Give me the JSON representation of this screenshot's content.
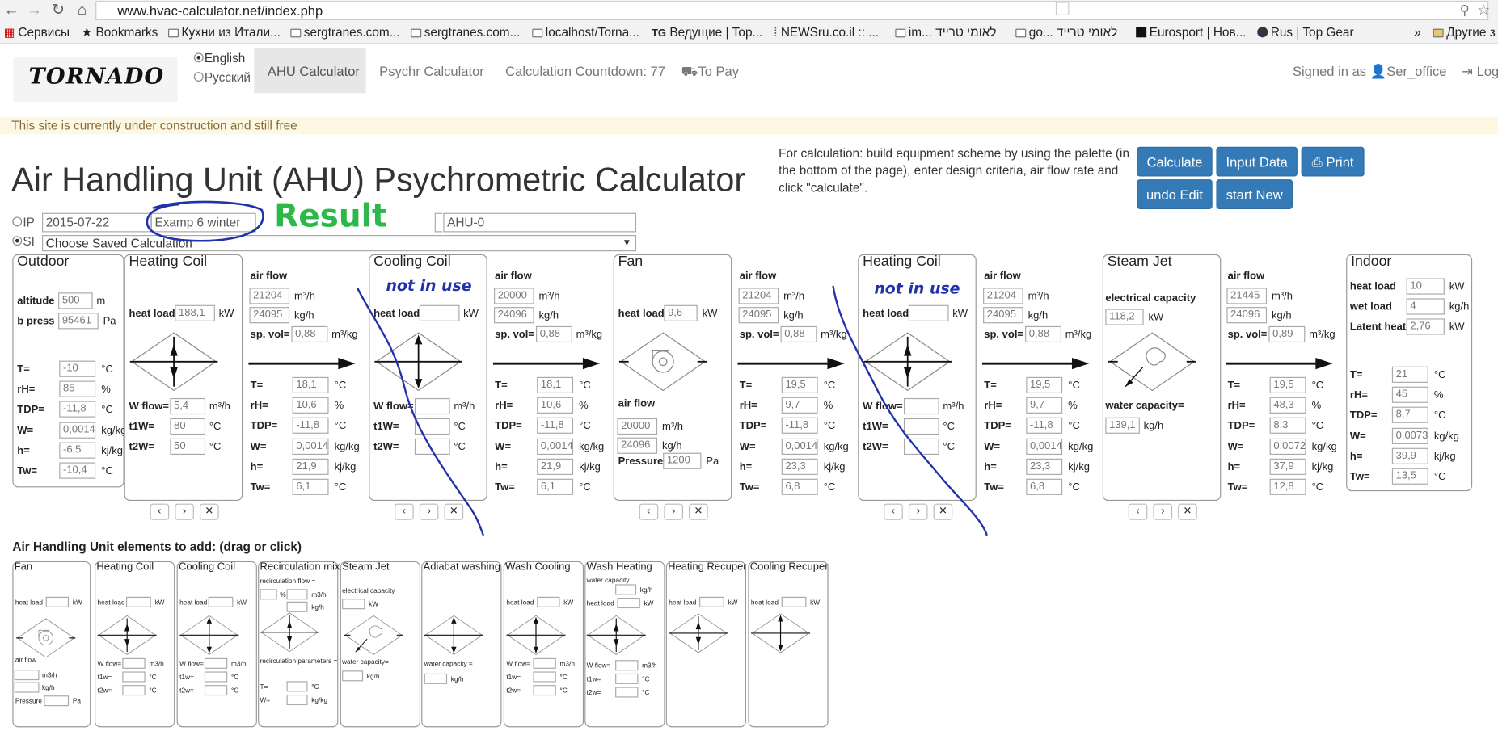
{
  "browser": {
    "url": "www.hvac-calculator.net/index.php",
    "bookmarks": [
      "Сервисы",
      "Bookmarks",
      "Кухни из Итали...",
      "sergtranes.com...",
      "sergtranes.com...",
      "localhost/Torna...",
      "Ведущие | Top...",
      "NEWSru.co.il :: ...",
      "im... לאומי טרייד",
      "go... לאומי טרייד",
      "Eurosport | Нов...",
      "Rus | Top Gear"
    ],
    "more": "»",
    "other_bookmarks": "Другие з"
  },
  "nav": {
    "logo": "TORNADO",
    "lang_en": "English",
    "lang_ru": "Русский",
    "ahu": "AHU Calculator",
    "psychr": "Psychr Calculator",
    "countdown": "Calculation Countdown: 77",
    "pay": "To Pay",
    "signed": "Signed in as ",
    "user": "Ser_office",
    "logout": "Log"
  },
  "warning": "This site is currently under construction and still free",
  "title": "Air Handling Unit (AHU) Psychrometric Calculator",
  "info": "For calculation: build equipment scheme by using the palette (in the bottom of the page), enter design criteria, air flow rate and click \"calculate\".",
  "buttons": {
    "calculate": "Calculate",
    "input": "Input Data",
    "print": "Print",
    "undo": "undo Edit",
    "start": "start New"
  },
  "units_ip": "IP",
  "units_si": "SI",
  "date": "2015-07-22",
  "name": "Examp 6 winter",
  "ahu_name": "AHU-0",
  "saved": "Choose Saved Calculation",
  "annotations": {
    "result": "Result",
    "notuse": "not in use"
  },
  "labels": {
    "T": "T=",
    "rH": "rH=",
    "TDP": "TDP=",
    "W": "W=",
    "h": "h=",
    "Tw": "Tw=",
    "airflow": "air flow",
    "spvol": "sp. vol=",
    "heatload": "heat load",
    "Wflow": "W flow=",
    "t1W": "t1W=",
    "t2W": "t2W=",
    "altitude": "altitude",
    "bpress": "b press",
    "pressure": "Pressure",
    "elcap": "electrical capacity",
    "watercap": "water capacity=",
    "wetload": "wet load",
    "latent": "Latent heat"
  },
  "units": {
    "C": "°C",
    "pct": "%",
    "kgkg": "kg/kg",
    "kjkg": "kj/kg",
    "m3h": "m³/h",
    "kgh": "kg/h",
    "m3kg": "m³/kg",
    "kW": "kW",
    "m": "m",
    "Pa": "Pa"
  },
  "outdoor": {
    "title": "Outdoor",
    "altitude": "500",
    "bpress": "95461",
    "T": "-10",
    "rH": "85",
    "TDP": "-11,8",
    "W": "0,00144",
    "h": "-6,5",
    "Tw": "-10,4"
  },
  "heat1": {
    "title": "Heating Coil",
    "heatload": "188,1",
    "Wflow": "5,4",
    "t1W": "80",
    "t2W": "50"
  },
  "flow1": {
    "airflow": "21204",
    "kgh": "24095",
    "spvol": "0,88",
    "T": "18,1",
    "rH": "10,6",
    "TDP": "-11,8",
    "W": "0,0014",
    "h": "21,9",
    "Tw": "6,1"
  },
  "cool": {
    "title": "Cooling Coil"
  },
  "flow2": {
    "airflow": "20000",
    "kgh": "24096",
    "spvol": "0,88",
    "T": "18,1",
    "rH": "10,6",
    "TDP": "-11,8",
    "W": "0,0014",
    "h": "21,9",
    "Tw": "6,1"
  },
  "fan": {
    "title": "Fan",
    "heatload": "9,6",
    "airflow": "20000",
    "kgh": "24096",
    "pressure": "1200"
  },
  "flow3": {
    "airflow": "21204",
    "kgh": "24095",
    "spvol": "0,88",
    "T": "19,5",
    "rH": "9,7",
    "TDP": "-11,8",
    "W": "0,0014",
    "h": "23,3",
    "Tw": "6,8"
  },
  "heat2": {
    "title": "Heating Coil"
  },
  "flow4": {
    "airflow": "21204",
    "kgh": "24095",
    "spvol": "0,88",
    "T": "19,5",
    "rH": "9,7",
    "TDP": "-11,8",
    "W": "0,0014",
    "h": "23,3",
    "Tw": "6,8"
  },
  "steam": {
    "title": "Steam Jet",
    "elcap": "118,2",
    "watercap": "139,1"
  },
  "flow5": {
    "airflow": "21445",
    "kgh": "24096",
    "spvol": "0,89",
    "T": "19,5",
    "rH": "48,3",
    "TDP": "8,3",
    "W": "0,0072",
    "h": "37,9",
    "Tw": "12,8"
  },
  "indoor": {
    "title": "Indoor",
    "heatload": "10",
    "wetload": "4",
    "latent": "2,76",
    "T": "21",
    "rH": "45",
    "TDP": "8,7",
    "W": "0,00738",
    "h": "39,9",
    "Tw": "13,5"
  },
  "palette": {
    "heading": "Air Handling Unit elements to add: (drag or click)",
    "items": [
      "Fan",
      "Heating Coil",
      "Cooling Coil",
      "Recirculation mix",
      "Steam Jet",
      "Adiabat washing",
      "Wash Cooling",
      "Wash Heating",
      "Heating Recuper",
      "Cooling Recuper"
    ],
    "texts": {
      "heatload": "heat load",
      "kW": "kW",
      "airflow": "air flow",
      "m3h": "m3/h",
      "kgh": "kg/h",
      "pressure": "Pressure",
      "Pa": "Pa",
      "wflow": "W flow=",
      "t1w": "t1w=",
      "t2w": "t2w=",
      "C": "°C",
      "recflow": "recirculation flow =",
      "pct": "%",
      "recparams": "recirculation parameters =",
      "T": "T=",
      "W": "W=",
      "kgkg": "kg/kg",
      "elcap": "electrical capacity",
      "watercap": "water capacity=",
      "watercap2": "water capacity =",
      "watercap3": "water capacity"
    }
  }
}
